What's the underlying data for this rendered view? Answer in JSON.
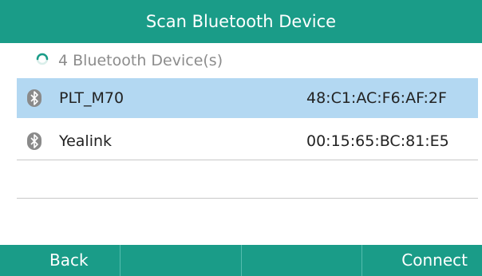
{
  "window": {
    "title": "Scan Bluetooth Device"
  },
  "status": {
    "icon": "loading-spinner-icon",
    "text": "4 Bluetooth Device(s)"
  },
  "devices": [
    {
      "name": "PLT_M70",
      "mac": "48:C1:AC:F6:AF:2F",
      "selected": true,
      "icon": "bluetooth-icon"
    },
    {
      "name": "Yealink",
      "mac": "00:15:65:BC:81:E5",
      "selected": false,
      "icon": "bluetooth-icon"
    }
  ],
  "softkeys": {
    "left": "Back",
    "key2": "",
    "key3": "",
    "right": "Connect"
  },
  "colors": {
    "accent": "#1a9c88",
    "selection": "#b3d8f2"
  }
}
